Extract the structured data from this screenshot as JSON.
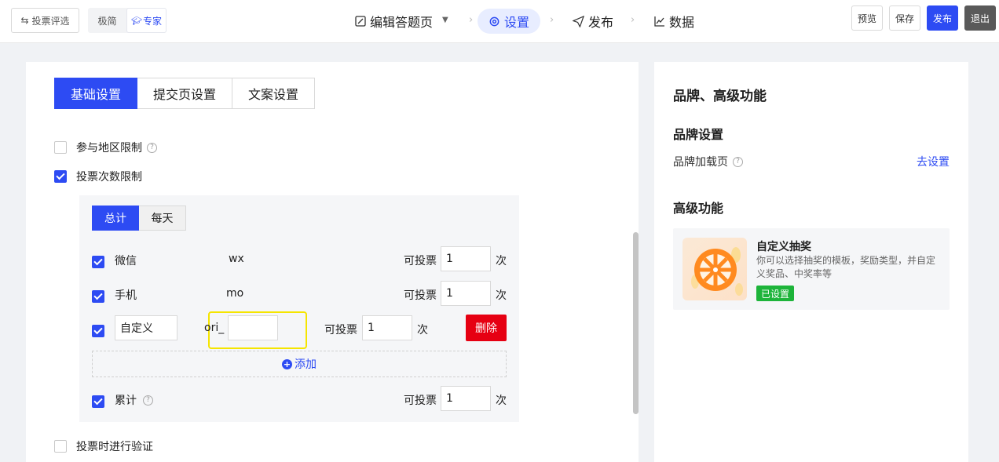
{
  "header": {
    "back_label": "投票评选",
    "modes": [
      "极简",
      "专家"
    ],
    "steps": [
      "编辑答题页",
      "设置",
      "发布",
      "数据"
    ],
    "buttons": {
      "preview": "预览",
      "save": "保存",
      "publish": "发布",
      "exit": "退出"
    }
  },
  "main": {
    "tabs": [
      "基础设置",
      "提交页设置",
      "文案设置"
    ],
    "region_limit": {
      "label": "参与地区限制",
      "checked": false
    },
    "vote_limit": {
      "label": "投票次数限制",
      "checked": true
    },
    "vote_panel": {
      "subtabs": [
        "总计",
        "每天"
      ],
      "votable_label": "可投票",
      "unit": "次",
      "rows": [
        {
          "name": "微信",
          "code": "wx",
          "count": "1",
          "checked": true
        },
        {
          "name": "手机",
          "code": "mo",
          "count": "1",
          "checked": true
        }
      ],
      "custom_row": {
        "name": "自定义",
        "prefix": "ori_",
        "suffix_value": "",
        "count": "1",
        "checked": true,
        "delete_label": "删除"
      },
      "add_label": "添加",
      "total_row": {
        "name": "累计",
        "count": "1",
        "checked": true
      }
    },
    "verify": {
      "label": "投票时进行验证",
      "checked": false
    }
  },
  "side": {
    "title": "品牌、高级功能",
    "brand_heading": "品牌设置",
    "brand_loading_label": "品牌加载页",
    "go_setting": "去设置",
    "advanced_heading": "高级功能",
    "lottery": {
      "title": "自定义抽奖",
      "desc": "你可以选择抽奖的模板，奖励类型，并自定义奖品、中奖率等",
      "status": "已设置"
    }
  },
  "colors": {
    "accent": "#2d4bf3",
    "danger": "#e60012",
    "success": "#1db43a",
    "highlight": "#f5e500"
  }
}
